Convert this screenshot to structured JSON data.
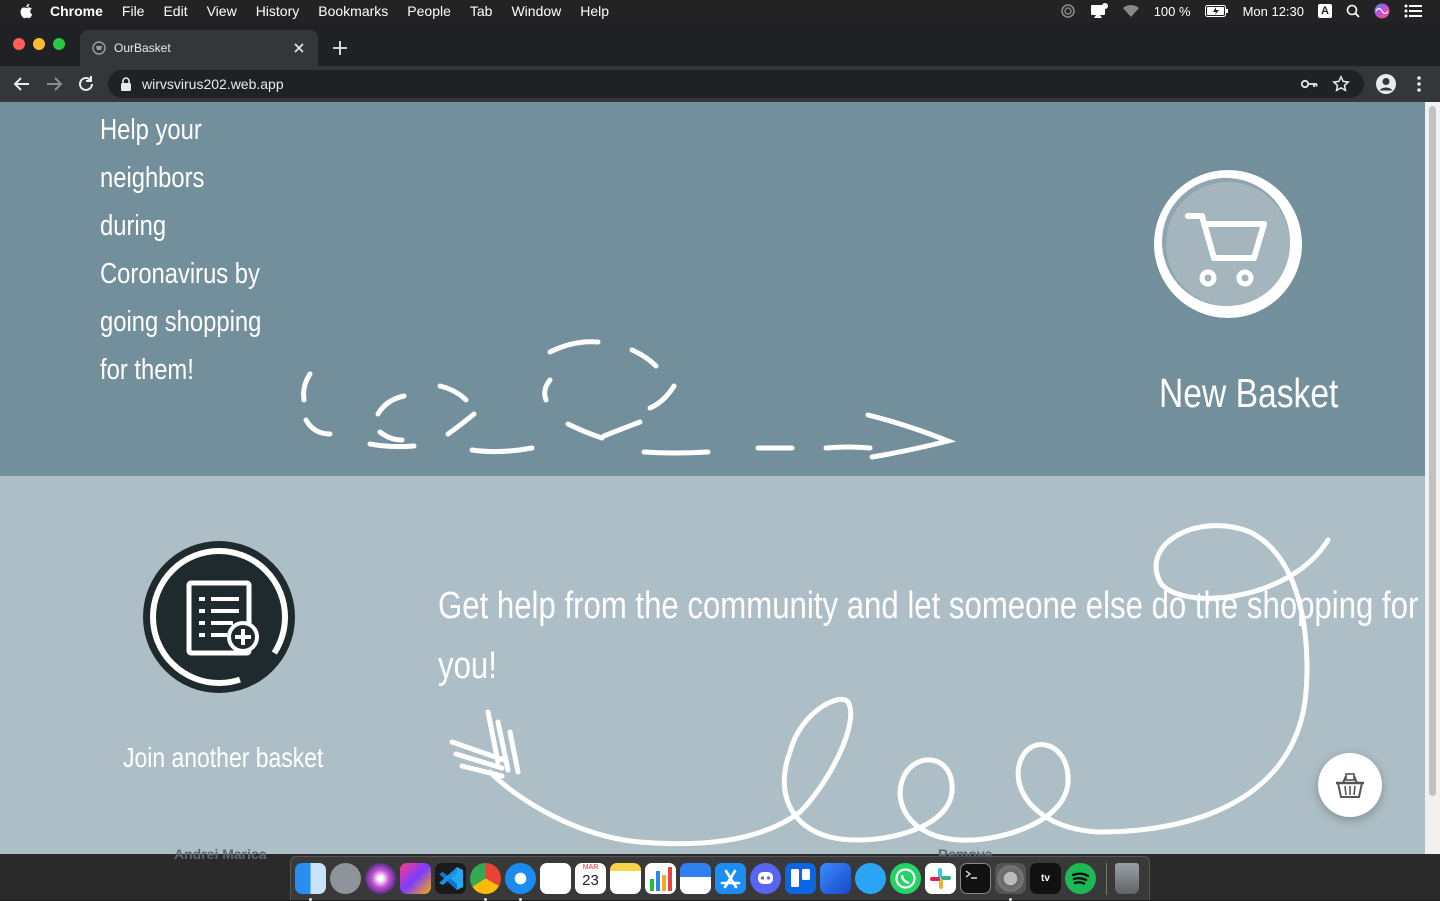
{
  "menubar": {
    "app_name": "Chrome",
    "menus": [
      "File",
      "Edit",
      "View",
      "History",
      "Bookmarks",
      "People",
      "Tab",
      "Window",
      "Help"
    ],
    "battery": "100 %",
    "clock": "Mon 12:30",
    "input_source": "A"
  },
  "browser": {
    "tab_title": "OurBasket",
    "url": "wirvsvirus202.web.app"
  },
  "page": {
    "tagline": "Help your neighbors during Coronavirus by going shopping for them!",
    "new_basket_label": "New Basket",
    "join_basket_label": "Join another basket",
    "community_text": "Get help from the community and let someone else do the shopping for you!"
  },
  "background_peek": {
    "left_text": "Andrei Marica",
    "right_text": "Remove"
  },
  "colors": {
    "hero_bg": "#738f9c",
    "lower_bg": "#aebec6",
    "dark_icon": "#1f2a2e"
  },
  "icons": {
    "new_basket": "shopping-cart-icon",
    "join_basket": "document-add-icon",
    "fab": "basket-icon"
  },
  "dock": {
    "apps": [
      "Finder",
      "Launchpad",
      "Siri",
      "JetBrains Toolbox",
      "Visual Studio Code",
      "Google Chrome",
      "Safari",
      "Reminders",
      "Calendar",
      "Notes",
      "Numbers",
      "Keynote",
      "App Store",
      "Discord",
      "Trello",
      "Pages",
      "Messages",
      "WhatsApp",
      "Slack",
      "Terminal",
      "System Preferences",
      "Apple TV",
      "Spotify"
    ],
    "calendar_day": "23",
    "calendar_month": "MAR",
    "tv_label": "tv",
    "trash": "Trash"
  }
}
